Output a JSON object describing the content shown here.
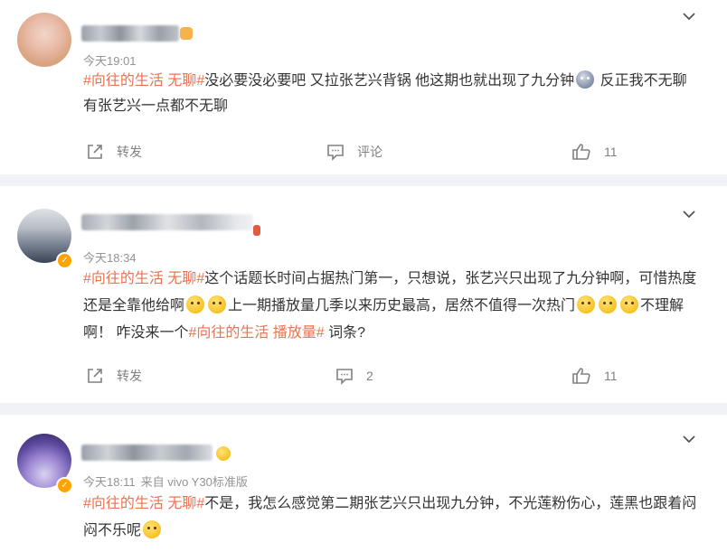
{
  "comments": [
    {
      "time": "今天19:01",
      "source": "",
      "verified": false,
      "segments": [
        {
          "type": "hashtag",
          "text": "#向往的生活 无聊#"
        },
        {
          "type": "text",
          "text": "没必要没必要吧 又拉张艺兴背锅 他这期也就出现了九分钟"
        },
        {
          "type": "emoji",
          "name": "scared-face-emoji"
        },
        {
          "type": "text",
          "text": " 反正我不无聊 有张艺兴一点都不无聊"
        }
      ],
      "repost_label": "转发",
      "comment_label": "评论",
      "like_count": "11"
    },
    {
      "time": "今天18:34",
      "source": "",
      "verified": true,
      "segments": [
        {
          "type": "hashtag",
          "text": "#向往的生活 无聊#"
        },
        {
          "type": "text",
          "text": "这个话题长时间占据热门第一，只想说，张艺兴只出现了九分钟啊，可惜热度还是全靠他给啊"
        },
        {
          "type": "emoji",
          "name": "crying-face-emoji"
        },
        {
          "type": "emoji",
          "name": "crying-face-emoji"
        },
        {
          "type": "text",
          "text": "上一期播放量几季以来历史最高，居然不值得一次热门"
        },
        {
          "type": "emoji",
          "name": "thinking-face-emoji"
        },
        {
          "type": "emoji",
          "name": "thinking-face-emoji"
        },
        {
          "type": "emoji",
          "name": "thinking-face-emoji"
        },
        {
          "type": "text",
          "text": "不理解啊！ 咋没来一个"
        },
        {
          "type": "hashtag",
          "text": "#向往的生活 播放量#"
        },
        {
          "type": "text",
          "text": " 词条?"
        }
      ],
      "repost_label": "转发",
      "comment_label": "2",
      "like_count": "11"
    },
    {
      "time": "今天18:11",
      "source": "来自 vivo Y30标准版",
      "verified": true,
      "segments": [
        {
          "type": "hashtag",
          "text": "#向往的生活 无聊#"
        },
        {
          "type": "text",
          "text": "不是，我怎么感觉第二期张艺兴只出现九分钟，不光莲粉伤心，莲黑也跟着闷闷不乐呢"
        },
        {
          "type": "emoji",
          "name": "smiling-face-emoji"
        }
      ]
    }
  ],
  "colors": {
    "hashtag": "#eb7350",
    "meta": "#939393",
    "action": "#808080",
    "background": "#f1f2f5",
    "verified_badge": "#ffa300"
  }
}
